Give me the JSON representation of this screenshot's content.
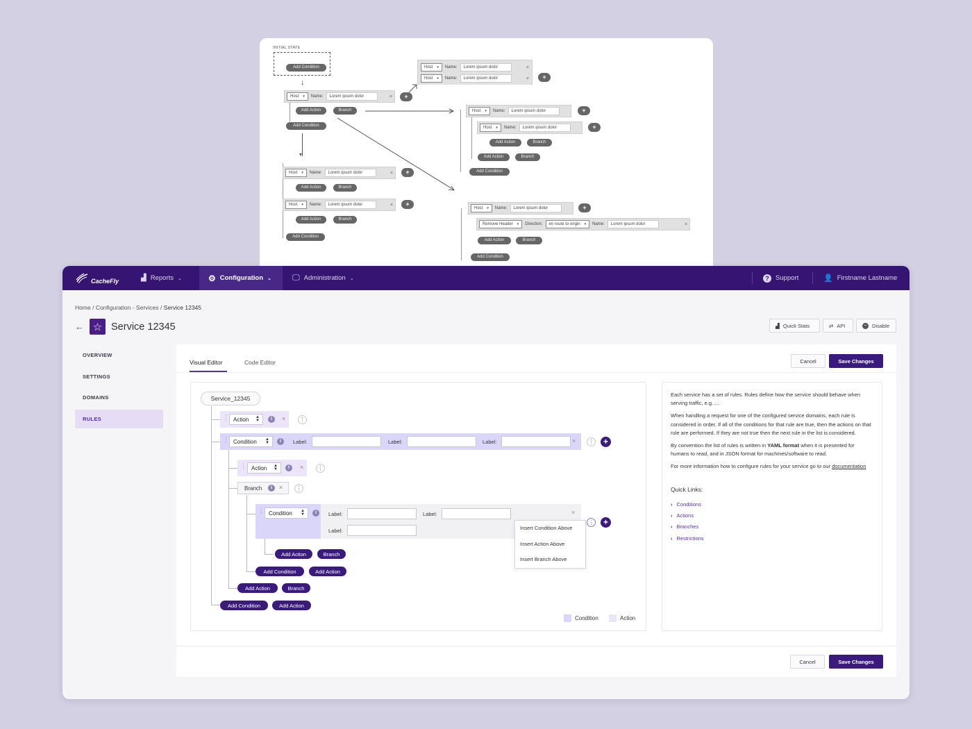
{
  "wireframe": {
    "initial_state": "INITIAL STATE",
    "add_condition": "Add Condition",
    "add_action": "Add Action",
    "branch": "Branch",
    "host": "Host",
    "name_label": "Name:",
    "name_value": "Lorem ipsum dolor",
    "remove_header": "Remove Header",
    "direction_label": "Direction:",
    "direction_value": "en route to origin",
    "close": "×",
    "plus": "+"
  },
  "nav": {
    "logo": "CacheFly",
    "reports": "Reports",
    "configuration": "Configuration",
    "administration": "Administration",
    "support": "Support",
    "user": "Firstname Lastname"
  },
  "breadcrumb": {
    "home": "Home",
    "sep": "/",
    "section": "Configuration - Services",
    "current": "Service 12345"
  },
  "page": {
    "title": "Service 12345",
    "quick_stats": "Quick Stats",
    "api": "API",
    "disable": "Disable"
  },
  "sidebar": {
    "items": [
      {
        "label": "OVERVIEW"
      },
      {
        "label": "SETTINGS"
      },
      {
        "label": "DOMAINS"
      },
      {
        "label": "RULES"
      }
    ]
  },
  "tabs": {
    "visual": "Visual Editor",
    "code": "Code Editor"
  },
  "buttons": {
    "cancel": "Cancel",
    "save": "Save Changes"
  },
  "editor": {
    "root": "Service_12345",
    "action": "Action",
    "condition": "Condition",
    "branch": "Branch",
    "label": "Label:",
    "add_action": "Add Action",
    "add_condition": "Add Condition",
    "branch_btn": "Branch",
    "close": "×",
    "kebab": "⋮",
    "plus": "+",
    "menu": [
      "Insert Condition Above",
      "Insert Action Above",
      "Insert Branch Above"
    ],
    "legend_condition": "Condition",
    "legend_action": "Action",
    "colors": {
      "condition": "#d9d6fa",
      "action": "#ece4f8",
      "primary": "#3a1a7c"
    }
  },
  "info": {
    "p1": "Each service has a set of rules. Rules define how the service should behave when serving traffic, e.g. ...",
    "p2": "When handling a request for one of the configured service domains, each rule is considered in order. If all of the conditions for that rule are true, then the actions on that rule are performed. If they are not true then the next rule in the list is considered.",
    "p3_pre": "By convention the list of rules is written in",
    "p3_bold": "YAML format",
    "p3_post": "when it is presented for humans to read, and in JSON format for machines/software to read.",
    "p4": "For more information how to configure rules for your service go to our",
    "doc_link": "documentation",
    "quick_links_title": "Quick Links:",
    "quick_links": [
      "Conditions",
      "Actions",
      "Branches",
      "Restrictions"
    ]
  }
}
